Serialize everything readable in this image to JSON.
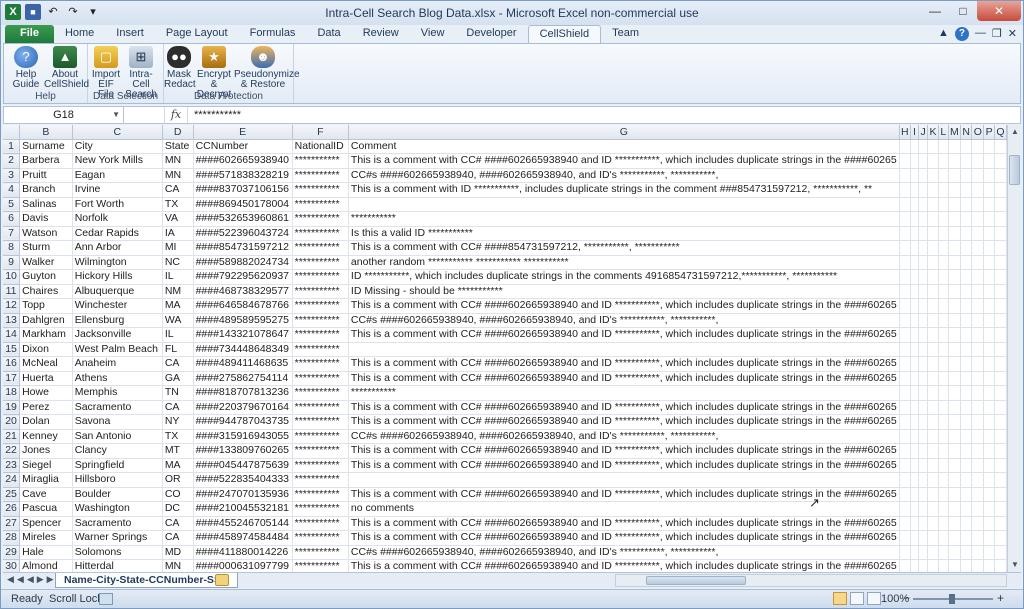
{
  "window": {
    "title": "Intra-Cell Search Blog Data.xlsx  -  Microsoft Excel non-commercial use"
  },
  "ribbon_tabs": [
    "File",
    "Home",
    "Insert",
    "Page Layout",
    "Formulas",
    "Data",
    "Review",
    "View",
    "Developer",
    "CellShield",
    "Team"
  ],
  "active_tab": "CellShield",
  "ribbon": {
    "help_group": {
      "label": "Help",
      "help_guide": "Help Guide",
      "about": "About CellShield"
    },
    "selection_group": {
      "label": "Data Selection",
      "import": "Import EIF File",
      "intra": "Intra-Cell Search"
    },
    "protection_group": {
      "label": "Data Protection",
      "mask": "Mask Redact",
      "encrypt": "Encrypt & Decrypt",
      "pseudo": "Pseudonymize & Restore"
    }
  },
  "formula_bar": {
    "name_box": "G18",
    "fx": "fx",
    "content": "***********"
  },
  "columns": [
    "B",
    "C",
    "D",
    "E",
    "F",
    "G",
    "H",
    "I",
    "J",
    "K",
    "L",
    "M",
    "N",
    "O",
    "P",
    "Q"
  ],
  "rows": [
    {
      "n": "1",
      "surname": "Surname",
      "city": "City",
      "state": "State",
      "cc": "CCNumber",
      "nid": "NationalID",
      "comment": "Comment"
    },
    {
      "n": "2",
      "surname": "Barbera",
      "city": "New York Mills",
      "state": "MN",
      "cc": "####602665938940",
      "nid": "***********",
      "comment": "This is a comment with CC# ####602665938940 and ID ***********, which includes duplicate strings in the ####60265"
    },
    {
      "n": "3",
      "surname": "Pruitt",
      "city": "Eagan",
      "state": "MN",
      "cc": "####571838328219",
      "nid": "***********",
      "comment": "CC#s ####602665938940, ####602665938940, and ID's ***********, ***********,"
    },
    {
      "n": "4",
      "surname": "Branch",
      "city": "Irvine",
      "state": "CA",
      "cc": "####837037106156",
      "nid": "***********",
      "comment": "This is a comment with ID ***********, includes duplicate strings in the comment ###854731597212, ***********, **"
    },
    {
      "n": "5",
      "surname": "Salinas",
      "city": "Fort Worth",
      "state": "TX",
      "cc": "####869450178004",
      "nid": "***********",
      "comment": ""
    },
    {
      "n": "6",
      "surname": "Davis",
      "city": "Norfolk",
      "state": "VA",
      "cc": "####532653960861",
      "nid": "***********",
      "comment": "***********"
    },
    {
      "n": "7",
      "surname": "Watson",
      "city": "Cedar Rapids",
      "state": "IA",
      "cc": "####522396043724",
      "nid": "***********",
      "comment": "Is this a valid ID ***********"
    },
    {
      "n": "8",
      "surname": "Sturm",
      "city": "Ann Arbor",
      "state": "MI",
      "cc": "####854731597212",
      "nid": "***********",
      "comment": "This is a comment with CC# ####854731597212, ***********, ***********"
    },
    {
      "n": "9",
      "surname": "Walker",
      "city": "Wilmington",
      "state": "NC",
      "cc": "####589882024734",
      "nid": "***********",
      "comment": "another random *********** ***********  ***********"
    },
    {
      "n": "10",
      "surname": "Guyton",
      "city": "Hickory Hills",
      "state": "IL",
      "cc": "####792295620937",
      "nid": "***********",
      "comment": "ID ***********, which includes duplicate strings in the comments 4916854731597212,***********, ***********"
    },
    {
      "n": "11",
      "surname": "Chaires",
      "city": "Albuquerque",
      "state": "NM",
      "cc": "####468738329577",
      "nid": "***********",
      "comment": "ID Missing - should be ***********"
    },
    {
      "n": "12",
      "surname": "Topp",
      "city": "Winchester",
      "state": "MA",
      "cc": "####646584678766",
      "nid": "***********",
      "comment": "This is a comment with CC# ####602665938940 and ID ***********, which includes duplicate strings in the ####60265"
    },
    {
      "n": "13",
      "surname": "Dahlgren",
      "city": "Ellensburg",
      "state": "WA",
      "cc": "####489589595275",
      "nid": "***********",
      "comment": "CC#s ####602665938940, ####602665938940, and ID's ***********, ***********,"
    },
    {
      "n": "14",
      "surname": "Markham",
      "city": "Jacksonville",
      "state": "IL",
      "cc": "####143321078647",
      "nid": "***********",
      "comment": "This is a comment with CC# ####602665938940 and ID ***********, which includes duplicate strings in the ####60265"
    },
    {
      "n": "15",
      "surname": "Dixon",
      "city": "West Palm Beach",
      "state": "FL",
      "cc": "####734448648349",
      "nid": "***********",
      "comment": ""
    },
    {
      "n": "16",
      "surname": "McNeal",
      "city": "Anaheim",
      "state": "CA",
      "cc": "####489411468635",
      "nid": "***********",
      "comment": "This is a comment with CC# ####602665938940 and ID ***********, which includes duplicate strings in the ####60265"
    },
    {
      "n": "17",
      "surname": "Huerta",
      "city": "Athens",
      "state": "GA",
      "cc": "####275862754114",
      "nid": "***********",
      "comment": "This is a comment with CC# ####602665938940 and ID ***********, which includes duplicate strings in the ####60265"
    },
    {
      "n": "18",
      "surname": "Howe",
      "city": "Memphis",
      "state": "TN",
      "cc": "####818707813236",
      "nid": "***********",
      "comment": "***********"
    },
    {
      "n": "19",
      "surname": "Perez",
      "city": "Sacramento",
      "state": "CA",
      "cc": "####220379670164",
      "nid": "***********",
      "comment": "This is a comment with CC# ####602665938940 and ID ***********, which includes duplicate strings in the ####60265"
    },
    {
      "n": "20",
      "surname": "Dolan",
      "city": "Savona",
      "state": "NY",
      "cc": "####944787043735",
      "nid": "***********",
      "comment": "This is a comment with CC# ####602665938940 and ID ***********, which includes duplicate strings in the ####60265"
    },
    {
      "n": "21",
      "surname": "Kenney",
      "city": "San Antonio",
      "state": "TX",
      "cc": "####315916943055",
      "nid": "***********",
      "comment": "CC#s ####602665938940, ####602665938940, and ID's ***********, ***********,"
    },
    {
      "n": "22",
      "surname": "Jones",
      "city": "Clancy",
      "state": "MT",
      "cc": "####133809760265",
      "nid": "***********",
      "comment": "This is a comment with CC# ####602665938940 and ID ***********, which includes duplicate strings in the ####60265"
    },
    {
      "n": "23",
      "surname": "Siegel",
      "city": "Springfield",
      "state": "MA",
      "cc": "####045447875639",
      "nid": "***********",
      "comment": "This is a comment with CC# ####602665938940 and ID ***********, which includes duplicate strings in the ####60265"
    },
    {
      "n": "24",
      "surname": "Miraglia",
      "city": "Hillsboro",
      "state": "OR",
      "cc": "####522835404333",
      "nid": "***********",
      "comment": ""
    },
    {
      "n": "25",
      "surname": "Cave",
      "city": "Boulder",
      "state": "CO",
      "cc": "####247070135936",
      "nid": "***********",
      "comment": "This is a comment with CC# ####602665938940 and ID ***********, which includes duplicate strings in the ####60265"
    },
    {
      "n": "26",
      "surname": "Pascua",
      "city": "Washington",
      "state": "DC",
      "cc": "####210045532181",
      "nid": "***********",
      "comment": "no comments"
    },
    {
      "n": "27",
      "surname": "Spencer",
      "city": "Sacramento",
      "state": "CA",
      "cc": "####455246705144",
      "nid": "***********",
      "comment": "This is a comment with CC# ####602665938940 and ID ***********, which includes duplicate strings in the ####60265"
    },
    {
      "n": "28",
      "surname": "Mireles",
      "city": "Warner Springs",
      "state": "CA",
      "cc": "####458974584484",
      "nid": "***********",
      "comment": "This is a comment with CC# ####602665938940 and ID ***********, which includes duplicate strings in the ####60265"
    },
    {
      "n": "29",
      "surname": "Hale",
      "city": "Solomons",
      "state": "MD",
      "cc": "####411880014226",
      "nid": "***********",
      "comment": "CC#s ####602665938940, ####602665938940, and ID's ***********, ***********,"
    },
    {
      "n": "30",
      "surname": "Almond",
      "city": "Hitterdal",
      "state": "MN",
      "cc": "####000631097799",
      "nid": "***********",
      "comment": "This is a comment with CC# ####602665938940 and ID ***********, which includes duplicate strings in the ####60265"
    }
  ],
  "sheet_tab": "Name-City-State-CCNumber-SSN",
  "status": {
    "ready": "Ready",
    "scroll_lock": "Scroll Lock",
    "zoom": "100%"
  },
  "colors": {
    "file_tab": "#1f7a3c",
    "accent": "#2f74c4"
  }
}
